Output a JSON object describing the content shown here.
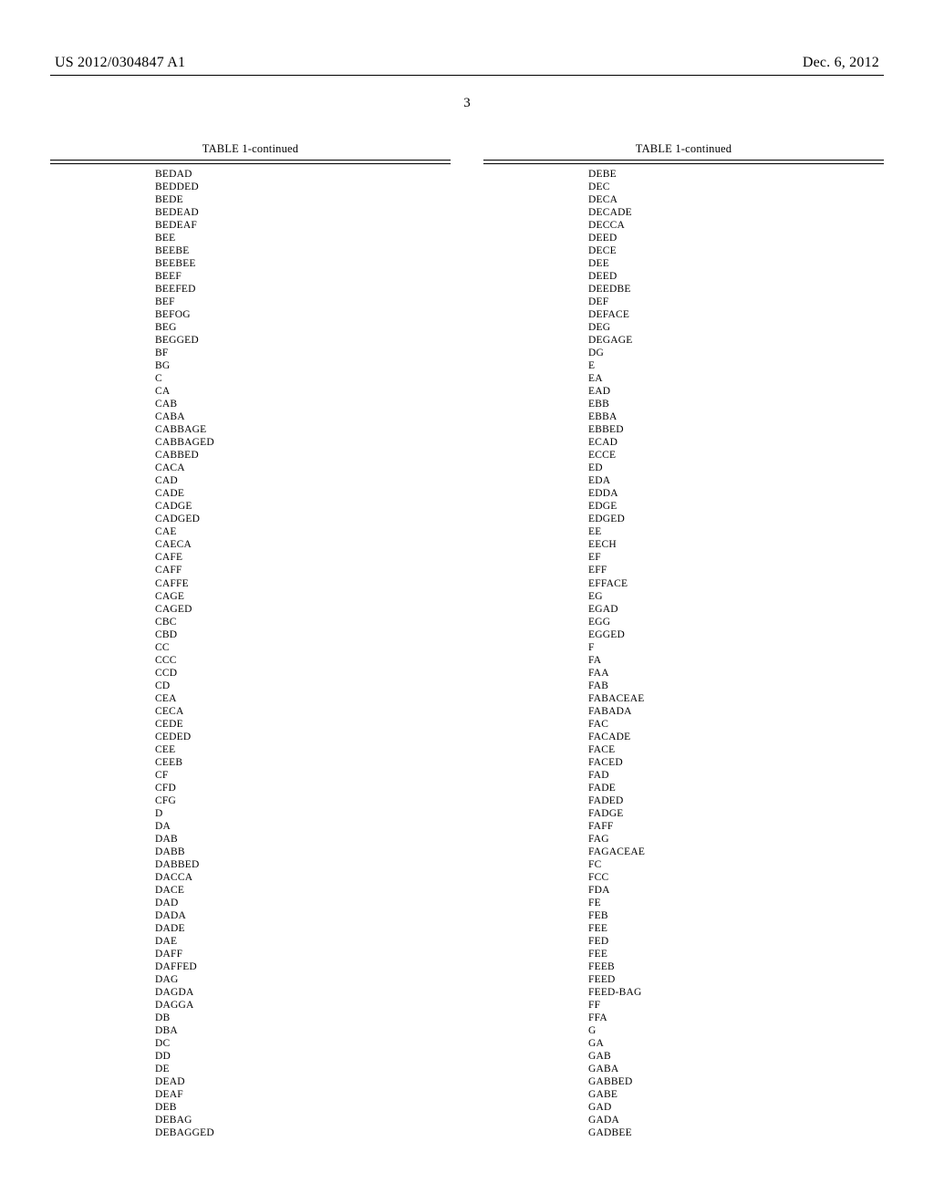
{
  "header": {
    "left": "US 2012/0304847 A1",
    "right": "Dec. 6, 2012"
  },
  "page_number": "3",
  "table_caption": "TABLE 1-continued",
  "columns": {
    "left": [
      "BEDAD",
      "BEDDED",
      "BEDE",
      "BEDEAD",
      "BEDEAF",
      "BEE",
      "BEEBE",
      "BEEBEE",
      "BEEF",
      "BEEFED",
      "BEF",
      "BEFOG",
      "BEG",
      "BEGGED",
      "BF",
      "BG",
      "C",
      "CA",
      "CAB",
      "CABA",
      "CABBAGE",
      "CABBAGED",
      "CABBED",
      "CACA",
      "CAD",
      "CADE",
      "CADGE",
      "CADGED",
      "CAE",
      "CAECA",
      "CAFE",
      "CAFF",
      "CAFFE",
      "CAGE",
      "CAGED",
      "CBC",
      "CBD",
      "CC",
      "CCC",
      "CCD",
      "CD",
      "CEA",
      "CECA",
      "CEDE",
      "CEDED",
      "CEE",
      "CEEB",
      "CF",
      "CFD",
      "CFG",
      "D",
      "DA",
      "DAB",
      "DABB",
      "DABBED",
      "DACCA",
      "DACE",
      "DAD",
      "DADA",
      "DADE",
      "DAE",
      "DAFF",
      "DAFFED",
      "DAG",
      "DAGDA",
      "DAGGA",
      "DB",
      "DBA",
      "DC",
      "DD",
      "DE",
      "DEAD",
      "DEAF",
      "DEB",
      "DEBAG",
      "DEBAGGED"
    ],
    "right": [
      "DEBE",
      "DEC",
      "DECA",
      "DECADE",
      "DECCA",
      "DEED",
      "DECE",
      "DEE",
      "DEED",
      "DEEDBE",
      "DEF",
      "DEFACE",
      "DEG",
      "DEGAGE",
      "DG",
      "E",
      "EA",
      "EAD",
      "EBB",
      "EBBA",
      "EBBED",
      "ECAD",
      "ECCE",
      "ED",
      "EDA",
      "EDDA",
      "EDGE",
      "EDGED",
      "EE",
      "EECH",
      "EF",
      "EFF",
      "EFFACE",
      "EG",
      "EGAD",
      "EGG",
      "EGGED",
      "F",
      "FA",
      "FAA",
      "FAB",
      "FABACEAE",
      "FABADA",
      "FAC",
      "FACADE",
      "FACE",
      "FACED",
      "FAD",
      "FADE",
      "FADED",
      "FADGE",
      "FAFF",
      "FAG",
      "FAGACEAE",
      "FC",
      "FCC",
      "FDA",
      "FE",
      "FEB",
      "FEE",
      "FED",
      "FEE",
      "FEEB",
      "FEED",
      "FEED-BAG",
      "FF",
      "FFA",
      "G",
      "GA",
      "GAB",
      "GABA",
      "GABBED",
      "GABE",
      "GAD",
      "GADA",
      "GADBEE"
    ]
  }
}
